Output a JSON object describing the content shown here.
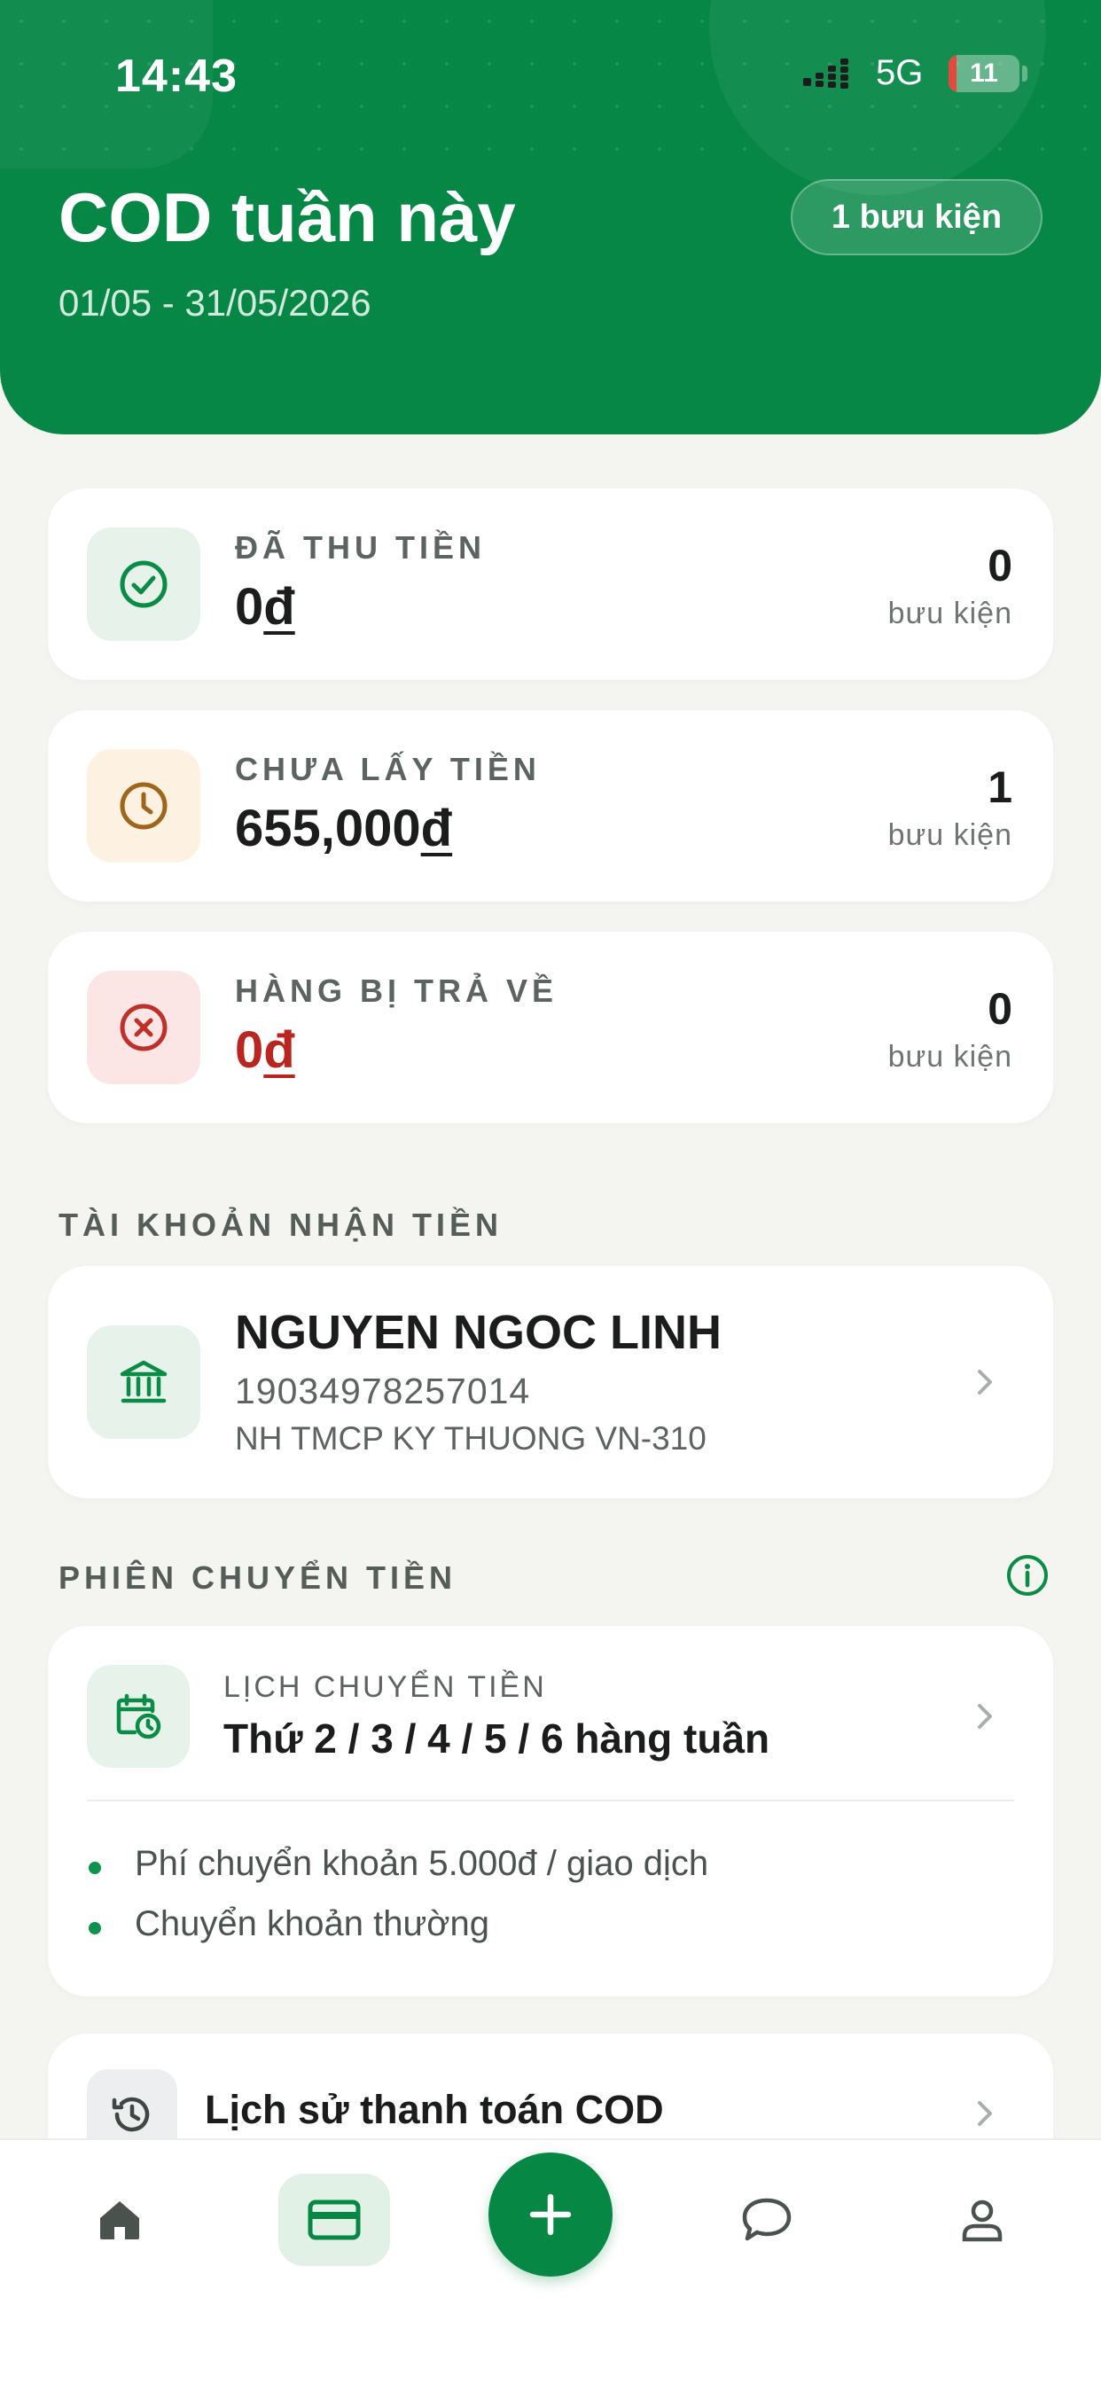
{
  "status_bar": {
    "time": "14:43",
    "network": "5G",
    "battery": "11",
    "battery_level": 0.11
  },
  "header": {
    "title": "COD tuần này",
    "date_range": "01/05 - 31/05/2026",
    "badge": "1 bưu kiện"
  },
  "stats": [
    {
      "label": "ĐÃ THU TIỀN",
      "amount": "0",
      "currency": "đ",
      "count": "0",
      "unit": "bưu kiện",
      "icon": "check-circle-icon",
      "color": "#0a8c47"
    },
    {
      "label": "CHƯA LẤY TIỀN",
      "amount": "655,000",
      "currency": "đ",
      "count": "1",
      "unit": "bưu kiện",
      "icon": "clock-icon",
      "color": "#a0651a"
    },
    {
      "label": "HÀNG BỊ TRẢ VỀ",
      "amount": "0",
      "currency": "đ",
      "count": "0",
      "unit": "bưu kiện",
      "icon": "x-circle-icon",
      "color": "#c0302a"
    }
  ],
  "account_section": {
    "title": "TÀI KHOẢN NHẬN TIỀN",
    "name": "NGUYEN NGOC LINH",
    "number": "19034978257014",
    "bank": "NH TMCP KY THUONG VN-310",
    "icon": "bank-icon"
  },
  "transfer_section": {
    "title": "PHIÊN CHUYỂN TIỀN",
    "info_icon": "info-icon",
    "schedule_label": "LỊCH CHUYỂN TIỀN",
    "schedule_value": "Thứ 2 / 3 / 4 / 5 / 6 hàng tuần",
    "notes": [
      "Phí chuyển khoản 5.000đ / giao dịch",
      "Chuyển khoản thường"
    ]
  },
  "history": {
    "label": "Lịch sử thanh toán COD",
    "icon": "history-icon"
  },
  "bottom_nav": {
    "items": [
      "home-icon",
      "card-icon",
      "plus-icon",
      "chat-icon",
      "profile-icon"
    ],
    "active": "card-icon"
  },
  "colors": {
    "primary": "#068746",
    "background": "#f4f4f1",
    "danger": "#b8261f"
  }
}
